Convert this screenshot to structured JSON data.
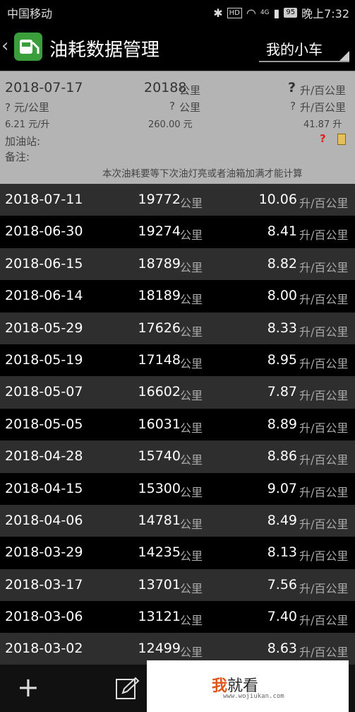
{
  "status": {
    "carrier": "中国移动",
    "hd": "HD",
    "net": "4G",
    "battery": "95",
    "time": "晚上7:32"
  },
  "header": {
    "title": "油耗数据管理",
    "car_select": "我的小车"
  },
  "detail": {
    "date": "2018-07-17",
    "odometer": "20188",
    "odometer_unit": "公里",
    "consumption": "?",
    "consumption_unit": "升/百公里",
    "price_per_km": "? 元/公里",
    "distance": "?",
    "distance_unit": "公里",
    "fuel": "?",
    "fuel_unit": "升/百公里",
    "unit_price": "6.21 元/升",
    "amount": "260.00 元",
    "liters": "41.87 升",
    "station_label": "加油站:",
    "station_mark": "?",
    "note_label": "备注:",
    "hint": "本次油耗要等下次油灯亮或者油箱加满才能计算"
  },
  "records": [
    {
      "date": "2018-07-11",
      "km": "19772",
      "cons": "10.06"
    },
    {
      "date": "2018-06-30",
      "km": "19274",
      "cons": "8.41"
    },
    {
      "date": "2018-06-15",
      "km": "18789",
      "cons": "8.82"
    },
    {
      "date": "2018-06-14",
      "km": "18189",
      "cons": "8.00"
    },
    {
      "date": "2018-05-29",
      "km": "17626",
      "cons": "8.33"
    },
    {
      "date": "2018-05-19",
      "km": "17148",
      "cons": "8.95"
    },
    {
      "date": "2018-05-07",
      "km": "16602",
      "cons": "7.87"
    },
    {
      "date": "2018-05-05",
      "km": "16031",
      "cons": "8.89"
    },
    {
      "date": "2018-04-28",
      "km": "15740",
      "cons": "8.86"
    },
    {
      "date": "2018-04-15",
      "km": "15300",
      "cons": "9.07"
    },
    {
      "date": "2018-04-06",
      "km": "14781",
      "cons": "8.49"
    },
    {
      "date": "2018-03-29",
      "km": "14235",
      "cons": "8.13"
    },
    {
      "date": "2018-03-17",
      "km": "13701",
      "cons": "7.56"
    },
    {
      "date": "2018-03-06",
      "km": "13121",
      "cons": "7.40"
    },
    {
      "date": "2018-03-02",
      "km": "12499",
      "cons": "8.63"
    }
  ],
  "units": {
    "km": "公里",
    "cons": "升/百公里"
  },
  "watermark": {
    "brand_a": "我",
    "brand_b": "就看",
    "url": "www.wojiukan.com"
  },
  "colors": {
    "detail_bg": "#b4b4b4",
    "row_alt": "#2e2e2e",
    "logo": "#3a9f3a",
    "red_mark": "#e02020"
  }
}
